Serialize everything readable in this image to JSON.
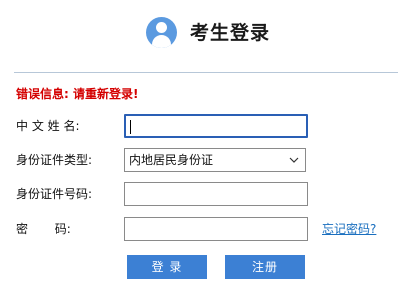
{
  "header": {
    "title": "考生登录",
    "avatar_icon": "user-avatar-icon"
  },
  "error": {
    "text": "错误信息: 请重新登录!",
    "color": "#d40000"
  },
  "form": {
    "name": {
      "label": "中 文 姓 名:",
      "value": ""
    },
    "id_type": {
      "label": "身份证件类型:",
      "selected": "内地居民身份证"
    },
    "id_number": {
      "label": "身份证件号码:",
      "value": ""
    },
    "password": {
      "label": "密       码:",
      "value": ""
    }
  },
  "links": {
    "forgot_password": "忘记密码?"
  },
  "buttons": {
    "login": "登 录",
    "register": "注册",
    "color": "#3c80d4"
  }
}
